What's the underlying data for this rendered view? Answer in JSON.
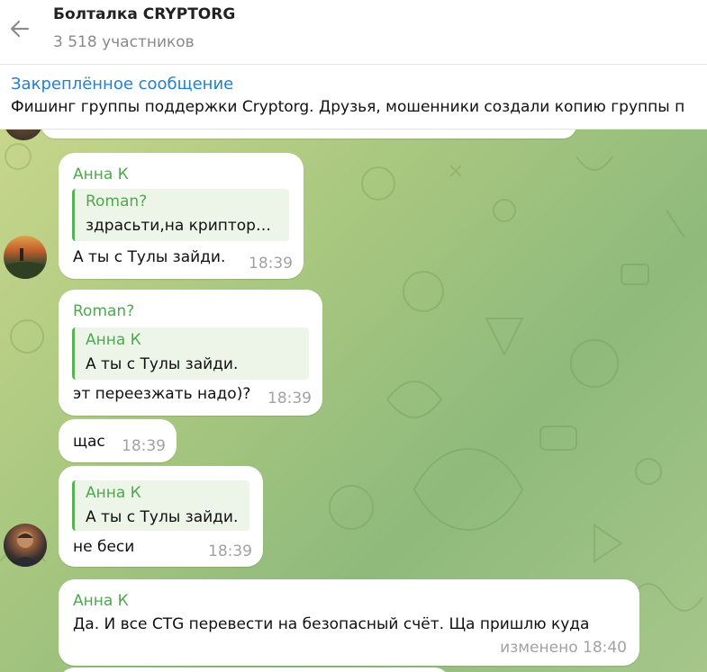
{
  "header": {
    "title": "Болталка CRYPTORG",
    "subtitle": "3 518 участников"
  },
  "pinned": {
    "title": "Закреплённое сообщение",
    "text": "Фишинг группы поддержки Cryptorg.  Друзья, мошенники создали копию группы п"
  },
  "messages": [
    {
      "sender": "Анна К",
      "reply": {
        "name": "Roman?",
        "text": "здрасьти,на криптор…"
      },
      "text": "А ты с Тулы зайди.",
      "time": "18:39"
    },
    {
      "sender": "Roman?",
      "reply": {
        "name": "Анна К",
        "text": "А ты с Тулы зайди."
      },
      "text": "эт переезжать надо)?",
      "time": "18:39"
    },
    {
      "text": "щас",
      "time": "18:39"
    },
    {
      "reply": {
        "name": "Анна К",
        "text": "А ты с Тулы зайди."
      },
      "text": "не беси",
      "time": "18:39"
    },
    {
      "sender": "Анна К",
      "text": "Да. И все CTG перевести на безопасный счёт. Ща пришлю куда",
      "time": "изменено 18:40"
    }
  ],
  "colors": {
    "accent": "#2481cc",
    "sender_name": "#4fa84f",
    "reply_bar": "#58b358",
    "time": "#a2a2a2"
  },
  "icons": {
    "back": "arrow-left-icon"
  }
}
